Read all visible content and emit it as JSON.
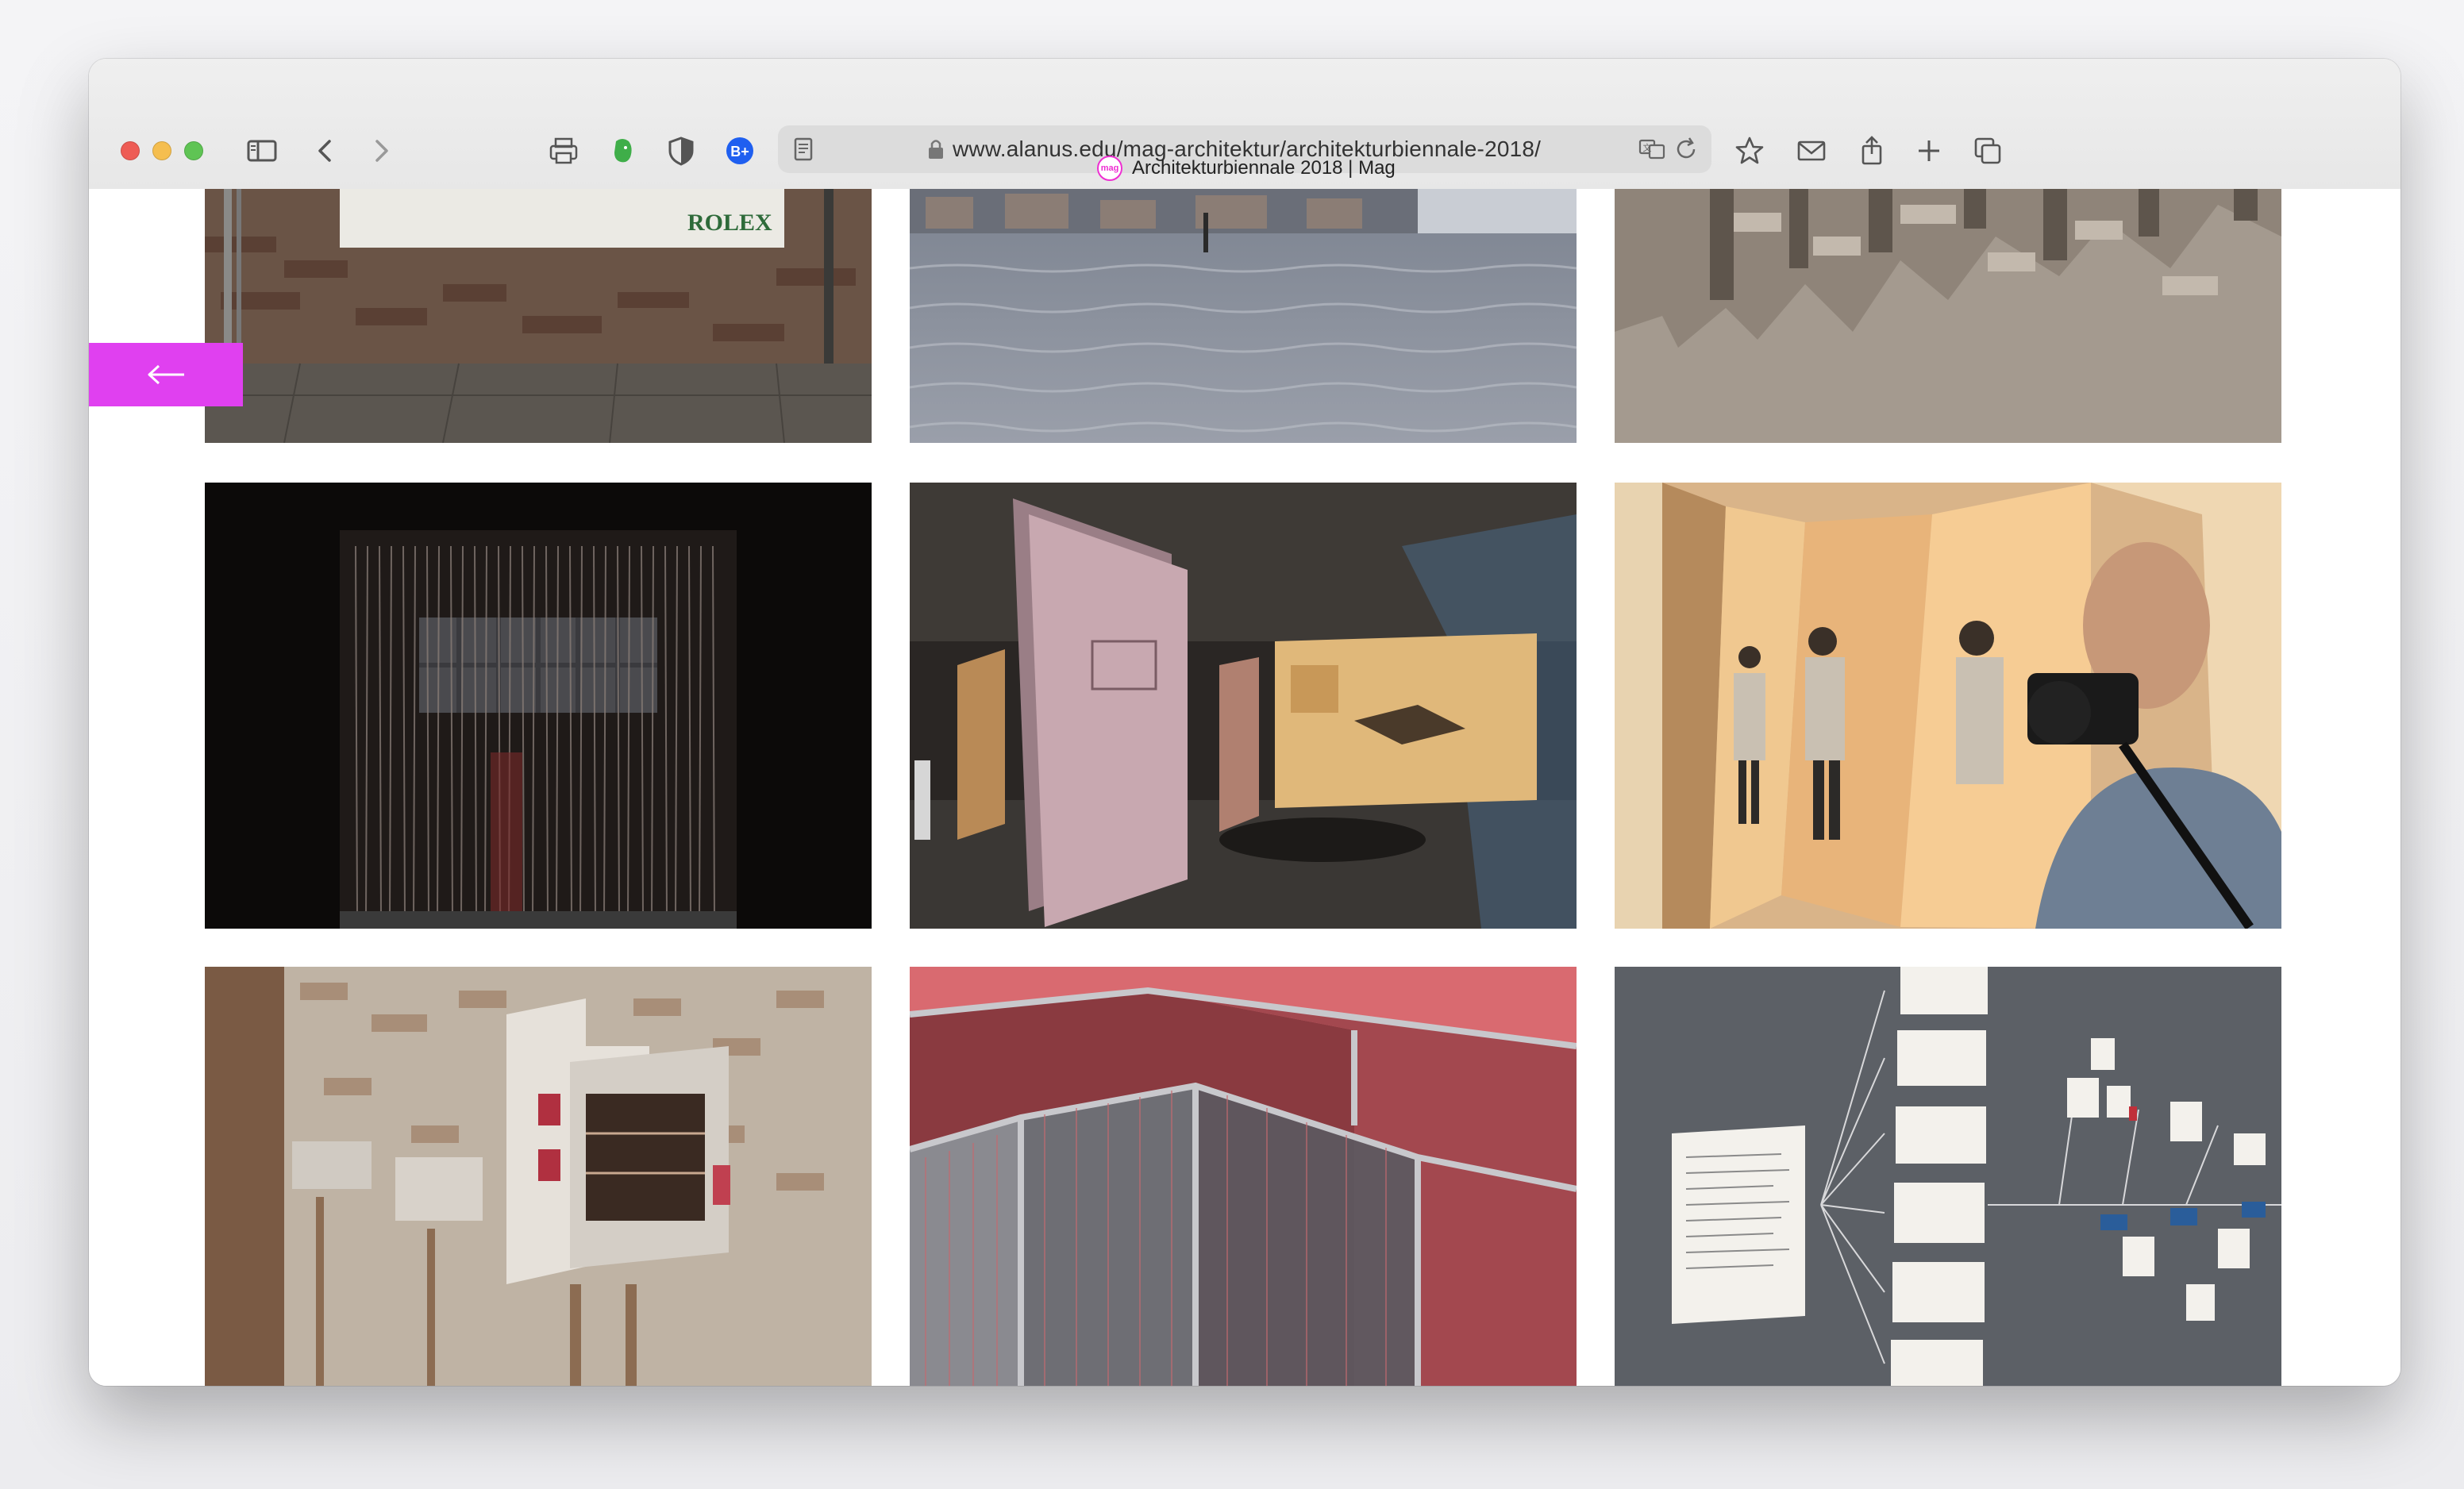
{
  "browser": {
    "url": "www.alanus.edu/mag-architektur/architekturbiennale-2018/",
    "tab_title": "Architekturbiennale 2018 | Mag",
    "favicon_text": "mag",
    "extension_badge": "B+"
  },
  "page": {
    "back_arrow": "←",
    "sign_text": "ROLEX",
    "accent_color": "#e040f0",
    "gallery": [
      {
        "name": "photo-rolex-wall"
      },
      {
        "name": "photo-venice-water"
      },
      {
        "name": "photo-felt-model"
      },
      {
        "name": "photo-string-curtain"
      },
      {
        "name": "photo-hanging-panels"
      },
      {
        "name": "photo-mirror-photographer"
      },
      {
        "name": "photo-house-model"
      },
      {
        "name": "photo-red-thread-maze"
      },
      {
        "name": "photo-wall-diagram"
      }
    ]
  },
  "colors": {
    "close": "#ee5c55",
    "minimize": "#f5be4f",
    "zoom": "#5fc454"
  }
}
